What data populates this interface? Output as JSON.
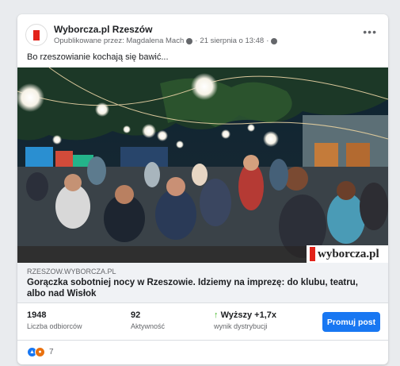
{
  "post": {
    "page_name": "Wyborcza.pl Rzeszów",
    "published_by": "Opublikowane przez: Magdalena Mach",
    "date": "21 sierpnia o 13:48",
    "separator": "·",
    "more_label": "•••",
    "caption": "Bo rzeszowianie kochają się bawić..."
  },
  "image": {
    "watermark_text": "wyborcza.pl",
    "description_icon": "party-crowd-photo"
  },
  "link": {
    "domain": "RZESZOW.WYBORCZA.PL",
    "title": "Gorączka sobotniej nocy w Rzeszowie. Idziemy na imprezę: do klubu, teatru, albo nad Wisłok"
  },
  "stats": {
    "reach_value": "1948",
    "reach_label": "Liczba odbiorców",
    "engagement_value": "92",
    "engagement_label": "Aktywność",
    "distribution_value": "Wyższy +1,7x",
    "distribution_arrow": "↑",
    "distribution_label": "wynik dystrybucji",
    "promote_label": "Promuj post"
  },
  "reactions": {
    "count": "7",
    "types": [
      "like-icon",
      "angry-icon"
    ]
  },
  "colors": {
    "accent": "#1877f2",
    "brand_red": "#e2231a",
    "positive": "#42b72a"
  }
}
